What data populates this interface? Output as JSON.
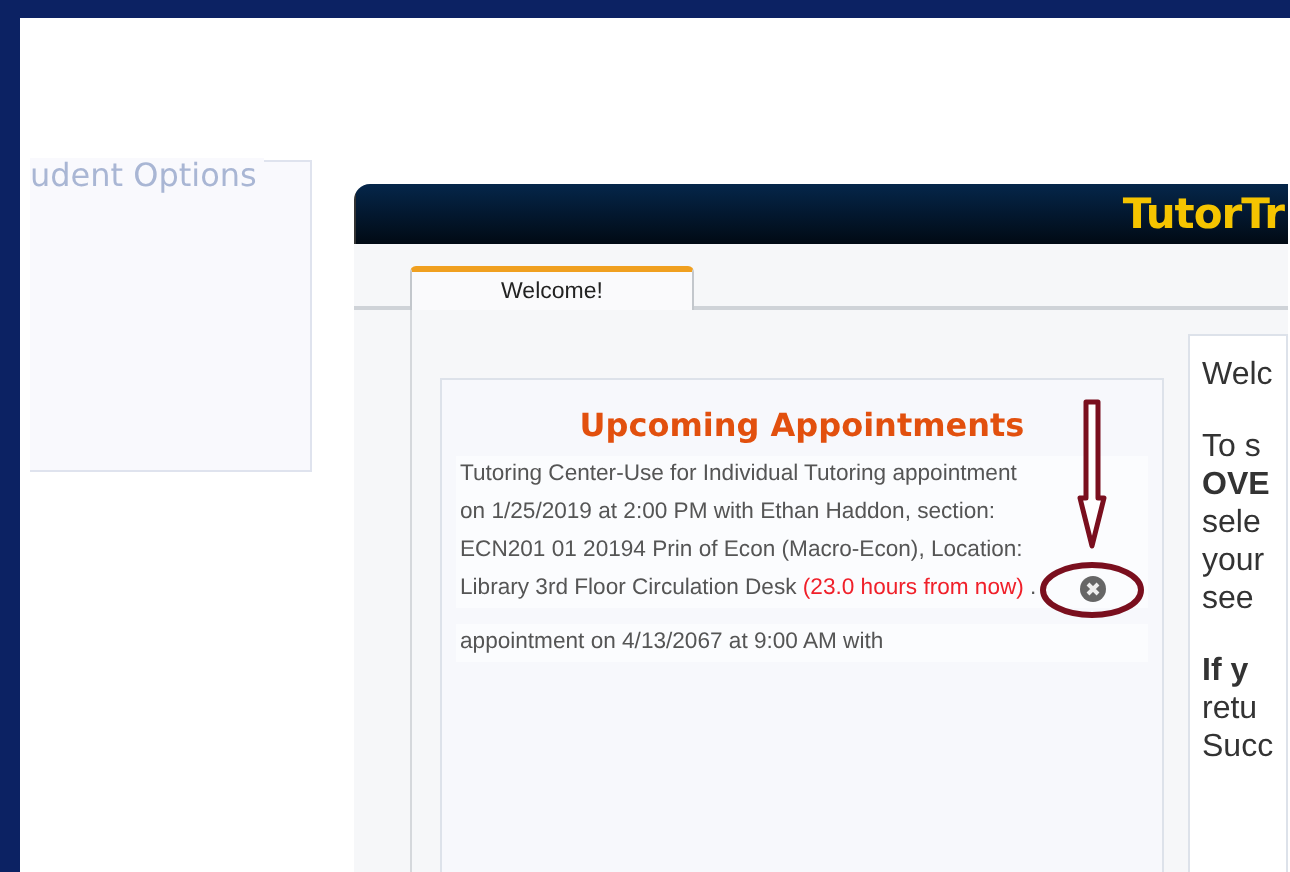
{
  "sidebar": {
    "legend": "udent Options"
  },
  "window": {
    "title": "TutorTr"
  },
  "tabs": [
    {
      "label": "Welcome!",
      "selected": true
    }
  ],
  "appointments": {
    "title": "Upcoming Appointments",
    "items": [
      {
        "text": "Tutoring Center-Use for Individual Tutoring appointment on 1/25/2019 at 2:00 PM with Ethan Haddon, section: ECN201 01 20194 Prin of Econ (Macro-Econ), Location: Library 3rd Floor Circulation Desk",
        "countdown": "(23.0 hours from now)",
        "end": ".",
        "removable": true
      },
      {
        "text": "appointment on 4/13/2067 at 9:00 AM with",
        "removable": false
      }
    ]
  },
  "welcome_panel": {
    "paragraphs": [
      {
        "lines": [
          {
            "text": "Welc",
            "bold": false
          }
        ]
      },
      {
        "lines": [
          {
            "text": "To s",
            "bold": false
          },
          {
            "text": "OVE",
            "bold": true
          },
          {
            "text": "sele",
            "bold": false
          },
          {
            "text": "your",
            "bold": false
          },
          {
            "text": "see",
            "bold": false
          }
        ]
      },
      {
        "lines": [
          {
            "text": "If y",
            "bold": true
          },
          {
            "text": "retu",
            "bold": false
          },
          {
            "text": "Succ",
            "bold": false
          }
        ]
      }
    ]
  }
}
